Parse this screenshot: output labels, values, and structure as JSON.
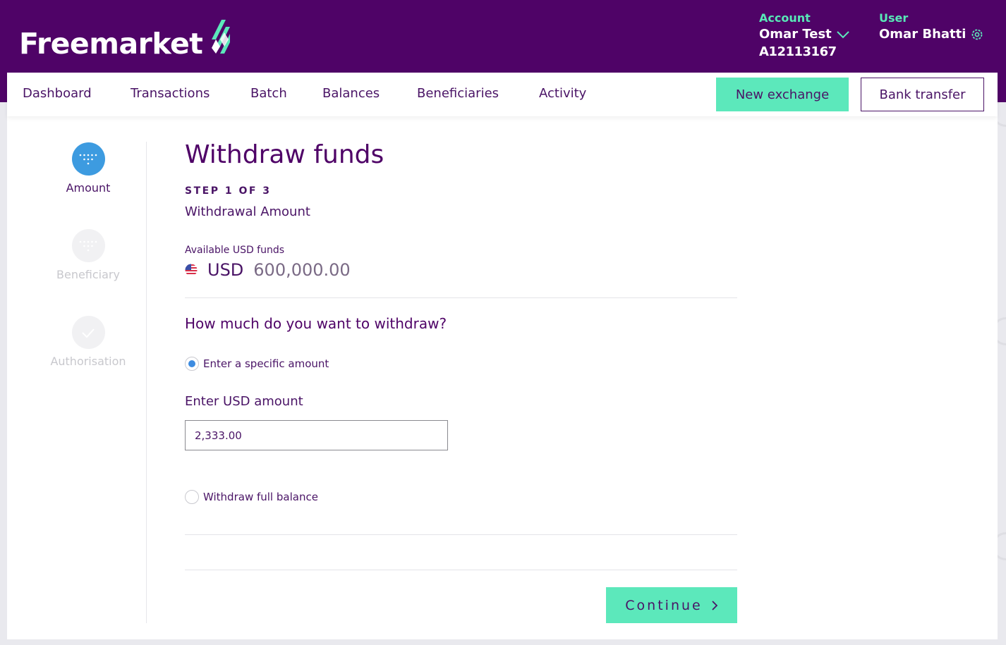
{
  "brand": {
    "name": "Freemarket"
  },
  "account": {
    "label": "Account",
    "name": "Omar Test",
    "id": "A12113167"
  },
  "user": {
    "label": "User",
    "name": "Omar Bhatti"
  },
  "nav": {
    "items": [
      "Dashboard",
      "Transactions",
      "Batch",
      "Balances",
      "Beneficiaries",
      "Activity"
    ],
    "new_exchange": "New exchange",
    "bank_transfer": "Bank transfer"
  },
  "stepper": [
    {
      "label": "Amount",
      "state": "active"
    },
    {
      "label": "Beneficiary",
      "state": "pending"
    },
    {
      "label": "Authorisation",
      "state": "pending"
    }
  ],
  "page": {
    "title": "Withdraw funds",
    "step_count": "STEP 1 OF 3",
    "step_name": "Withdrawal Amount",
    "available_label": "Available USD funds",
    "currency": "USD",
    "available_amount": "600,000.00",
    "question": "How much do you want to withdraw?",
    "option_specific": "Enter a specific amount",
    "option_full": "Withdraw full balance",
    "amount_label": "Enter USD amount",
    "amount_value": "2,333.00",
    "continue": "Continue"
  },
  "colors": {
    "header": "#4f0367",
    "accent": "#5ce8bb",
    "active_step": "#3d9be0"
  }
}
